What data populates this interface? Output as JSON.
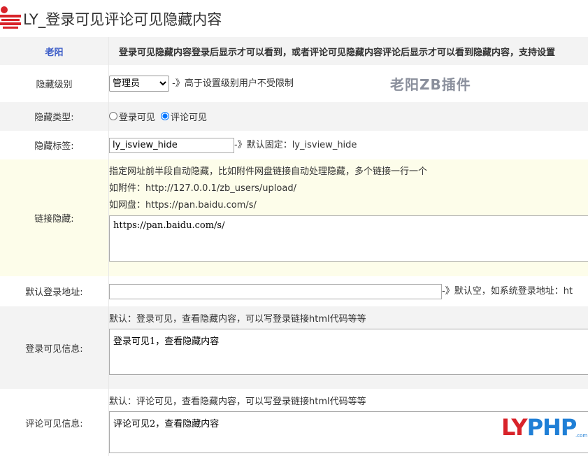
{
  "title": "LY_登录可见评论可见隐藏内容",
  "header_row": {
    "author": "老阳",
    "description": "登录可见隐藏内容登录后显示才可以看到，或者评论可见隐藏内容评论后显示才可以看到隐藏内容，支持设置"
  },
  "level": {
    "label": "隐藏级别",
    "selected": "管理员",
    "note": "-》高于设置级别用户不受限制"
  },
  "type": {
    "label": "隐藏类型:",
    "options": [
      "登录可见",
      "评论可见"
    ],
    "selected_index": 1
  },
  "tag": {
    "label": "隐藏标签:",
    "value": "ly_isview_hide",
    "note": "-》默认固定：ly_isview_hide"
  },
  "link_hide": {
    "label": "链接隐藏:",
    "desc": "指定网址前半段自动隐藏，比如附件网盘链接自动处理隐藏，多个链接一行一个",
    "example1": "如附件：http://127.0.0.1/zb_users/upload/",
    "example2": "如网盘：https://pan.baidu.com/s/",
    "value": "https://pan.baidu.com/s/"
  },
  "login_url": {
    "label": "默认登录地址:",
    "value": "",
    "note": "-》默认空，如系统登录地址：ht"
  },
  "login_info": {
    "label": "登录可见信息:",
    "desc": "默认：登录可见，查看隐藏内容，可以写登录链接html代码等等",
    "value": "登录可见1，查看隐藏内容"
  },
  "comment_info": {
    "label": "评论可见信息:",
    "desc": "默认：评论可见，查看隐藏内容，可以写登录链接html代码等等",
    "value": "评论可见2，查看隐藏内容"
  },
  "watermark": "老阳ZB插件",
  "brand": {
    "part1": "LY",
    "part2": "PHP",
    "suffix": ".com"
  },
  "colors": {
    "link_row_bg": "#fdfdea",
    "author_blue": "#3a5bc7",
    "brand_red": "#d8232a",
    "brand_blue": "#1f7fd6"
  }
}
